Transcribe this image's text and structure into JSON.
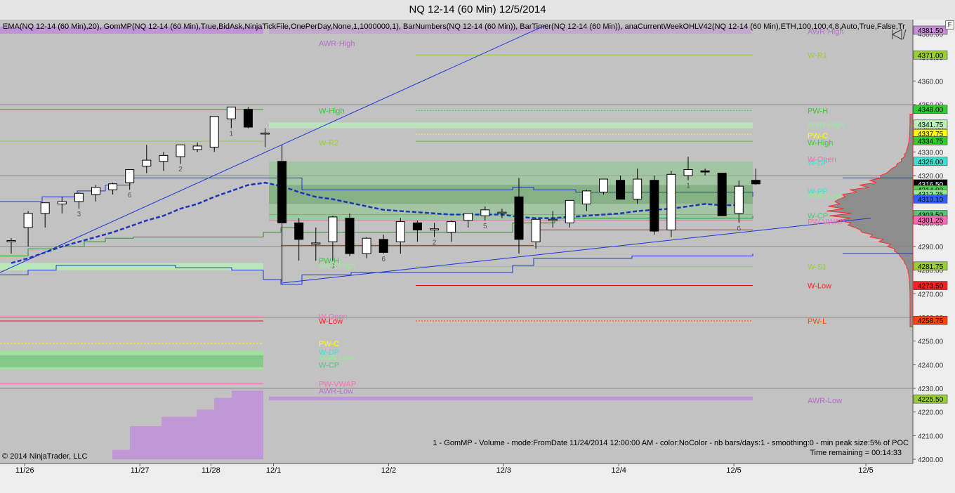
{
  "window": {
    "title": "NQ 12-14 (60 Min)  12/5/2014",
    "corner_button": "F"
  },
  "indicators_line": "EMA(NQ 12-14 (60 Min),20), GomMP(NQ 12-14 (60 Min),True,BidAsk,NinjaTickFile,OnePerDay,None,1,1000000,1), BarNumbers(NQ 12-14 (60 Min)), BarTimer(NQ 12-14 (60 Min)), anaCurrentWeekOHLV42(NQ 12-14 (60 Min),ETH,100,100,4,8,Auto,True,False,Tr",
  "gom_info": "1 - GomMP - Volume - mode:FromDate 11/24/2014 12:00:00 AM  - color:NoColor - nb bars/days:1 - smoothing:0 - min peak size:5% of POC",
  "time_remaining": "Time remaining = 00:14:33",
  "copyright": "© 2014 NinjaTrader, LLC",
  "chart_data": {
    "type": "candlestick",
    "title": "NQ 12-14 (60 Min)  12/5/2014",
    "ylim": [
      4200,
      4384
    ],
    "y_ticks": [
      "4200.00",
      "4210.00",
      "4220.00",
      "4230.00",
      "4240.00",
      "4250.00",
      "4260.00",
      "4270.00",
      "4280.00",
      "4290.00",
      "4300.00",
      "4310.00",
      "4320.00",
      "4330.00",
      "4340.00",
      "4350.00",
      "4360.00",
      "4370.00",
      "4380.00"
    ],
    "x_labels": [
      {
        "label": "11/26",
        "idx": 0.8
      },
      {
        "label": "11/27",
        "idx": 7.6
      },
      {
        "label": "11/28",
        "idx": 11.8
      },
      {
        "label": "12/1",
        "idx": 15.5
      },
      {
        "label": "12/2",
        "idx": 22.3
      },
      {
        "label": "12/3",
        "idx": 29.1
      },
      {
        "label": "12/4",
        "idx": 35.9
      },
      {
        "label": "12/5",
        "idx": 42.7
      },
      {
        "label": "12/5",
        "idx": 50.5
      }
    ],
    "candles": [
      {
        "o": 4292,
        "h": 4293.5,
        "l": 4287,
        "c": 4292.5
      },
      {
        "o": 4298,
        "h": 4305,
        "l": 4290,
        "c": 4304
      },
      {
        "o": 4304,
        "h": 4307,
        "l": 4298,
        "c": 4308.5
      },
      {
        "o": 4308,
        "h": 4311,
        "l": 4304,
        "c": 4309
      },
      {
        "o": 4309,
        "h": 4313,
        "l": 4306,
        "c": 4312.5
      },
      {
        "o": 4312,
        "h": 4316,
        "l": 4309,
        "c": 4315
      },
      {
        "o": 4314,
        "h": 4317,
        "l": 4312,
        "c": 4316.5
      },
      {
        "o": 4317,
        "h": 4322,
        "l": 4314,
        "c": 4322.5
      },
      {
        "o": 4324,
        "h": 4333,
        "l": 4321,
        "c": 4326.5
      },
      {
        "o": 4326,
        "h": 4330,
        "l": 4322,
        "c": 4328.5
      },
      {
        "o": 4328,
        "h": 4333,
        "l": 4325,
        "c": 4333
      },
      {
        "o": 4331,
        "h": 4334,
        "l": 4330,
        "c": 4332.5
      },
      {
        "o": 4332,
        "h": 4345,
        "l": 4330,
        "c": 4345
      },
      {
        "o": 4344,
        "h": 4349,
        "l": 4340,
        "c": 4349
      },
      {
        "o": 4348,
        "h": 4349,
        "l": 4340,
        "c": 4340.5
      },
      {
        "o": 4338,
        "h": 4340,
        "l": 4332,
        "c": 4338
      },
      {
        "o": 4326,
        "h": 4333,
        "l": 4275,
        "c": 4300
      },
      {
        "o": 4300,
        "h": 4302,
        "l": 4284,
        "c": 4293
      },
      {
        "o": 4291,
        "h": 4298,
        "l": 4284,
        "c": 4291.5
      },
      {
        "o": 4292,
        "h": 4303,
        "l": 4284,
        "c": 4302.5
      },
      {
        "o": 4302,
        "h": 4304,
        "l": 4286,
        "c": 4287
      },
      {
        "o": 4287,
        "h": 4294,
        "l": 4285,
        "c": 4293.5
      },
      {
        "o": 4293,
        "h": 4295,
        "l": 4287,
        "c": 4287.5
      },
      {
        "o": 4292,
        "h": 4302,
        "l": 4287,
        "c": 4300.5
      },
      {
        "o": 4300,
        "h": 4301,
        "l": 4292,
        "c": 4297
      },
      {
        "o": 4297,
        "h": 4300,
        "l": 4294,
        "c": 4297.5
      },
      {
        "o": 4296,
        "h": 4301,
        "l": 4292,
        "c": 4300.5
      },
      {
        "o": 4301,
        "h": 4304,
        "l": 4298,
        "c": 4304
      },
      {
        "o": 4303,
        "h": 4307,
        "l": 4301,
        "c": 4305.5
      },
      {
        "o": 4304,
        "h": 4306,
        "l": 4302,
        "c": 4304.5
      },
      {
        "o": 4311,
        "h": 4319,
        "l": 4287,
        "c": 4293
      },
      {
        "o": 4292,
        "h": 4302,
        "l": 4289,
        "c": 4301.5
      },
      {
        "o": 4301,
        "h": 4305,
        "l": 4298,
        "c": 4301.5
      },
      {
        "o": 4300,
        "h": 4309,
        "l": 4298,
        "c": 4309.5
      },
      {
        "o": 4308,
        "h": 4314,
        "l": 4305,
        "c": 4313.5
      },
      {
        "o": 4313,
        "h": 4318,
        "l": 4312,
        "c": 4318.5
      },
      {
        "o": 4318,
        "h": 4320,
        "l": 4310,
        "c": 4310
      },
      {
        "o": 4310,
        "h": 4323,
        "l": 4308,
        "c": 4318.5
      },
      {
        "o": 4318,
        "h": 4320,
        "l": 4295,
        "c": 4296.5
      },
      {
        "o": 4297,
        "h": 4322,
        "l": 4294,
        "c": 4320.5
      },
      {
        "o": 4320,
        "h": 4328,
        "l": 4318,
        "c": 4322.5
      },
      {
        "o": 4322,
        "h": 4323,
        "l": 4320,
        "c": 4321.5
      },
      {
        "o": 4321,
        "h": 4321,
        "l": 4303,
        "c": 4303
      },
      {
        "o": 4304,
        "h": 4318,
        "l": 4300,
        "c": 4315.5
      },
      {
        "o": 4318,
        "h": 4323,
        "l": 4316,
        "c": 4316.5
      }
    ],
    "bar_numbers": [
      {
        "n": "1",
        "idx": 13
      },
      {
        "n": "2",
        "idx": 10
      },
      {
        "n": "3",
        "idx": 4
      },
      {
        "n": "6",
        "idx": 7
      },
      {
        "n": "3",
        "idx": 19
      },
      {
        "n": "6",
        "idx": 22
      },
      {
        "n": "2",
        "idx": 25
      },
      {
        "n": "5",
        "idx": 28
      },
      {
        "n": "6",
        "idx": 43
      },
      {
        "n": "1",
        "idx": 40
      }
    ],
    "ema": [
      4283,
      4285,
      4287.5,
      4290,
      4292,
      4294,
      4296,
      4298.5,
      4301,
      4303,
      4306,
      4308,
      4311,
      4313.5,
      4316,
      4317,
      4315.5,
      4313,
      4311,
      4310,
      4308.5,
      4307,
      4305.5,
      4305,
      4304.5,
      4304,
      4303.5,
      4303.5,
      4303.5,
      4303.5,
      4302.5,
      4302,
      4302,
      4302.5,
      4303,
      4303.5,
      4304,
      4305,
      4305.5,
      4306,
      4307,
      4308,
      4307.5,
      4307.5
    ],
    "right_price_markers": [
      {
        "value": "4381.50",
        "bg": "#c88fd8",
        "y": 4381.5
      },
      {
        "value": "4371.00",
        "bg": "#9acd32",
        "y": 4371
      },
      {
        "value": "4348.00",
        "bg": "#32cd32",
        "y": 4348
      },
      {
        "value": "4341.75",
        "bg": "#b8f0b8",
        "y": 4341.75
      },
      {
        "value": "4337.75",
        "bg": "#ffff00",
        "y": 4337.75
      },
      {
        "value": "4334.75",
        "bg": "#32cd32",
        "y": 4334.75
      },
      {
        "value": "4326.00",
        "bg": "#40e0d0",
        "y": 4326
      },
      {
        "value": "4316.50",
        "bg": "#000000",
        "y": 4316.5,
        "fg": "#ffffff"
      },
      {
        "value": "4314.00",
        "bg": "#4fd04f",
        "y": 4314
      },
      {
        "value": "4312.25",
        "bg": "#90ee90",
        "y": 4312.25
      },
      {
        "value": "4310.10",
        "bg": "#3060ff",
        "y": 4310.1
      },
      {
        "value": "4303.50",
        "bg": "#50c878",
        "y": 4303.5
      },
      {
        "value": "4301.25",
        "bg": "#ff69b4",
        "y": 4301.25
      },
      {
        "value": "4281.75",
        "bg": "#9acd32",
        "y": 4281.75
      },
      {
        "value": "4273.50",
        "bg": "#ff2020",
        "y": 4273.5
      },
      {
        "value": "4258.75",
        "bg": "#ff4500",
        "y": 4258.75
      },
      {
        "value": "4225.50",
        "bg": "#9acd32",
        "y": 4225.5
      }
    ],
    "level_labels": [
      {
        "text": "AWR-High",
        "color": "#b36fc7",
        "y": 4381,
        "side": "right"
      },
      {
        "text": "AWR-High",
        "color": "#b36fc7",
        "y": 4376,
        "side": "left"
      },
      {
        "text": "W-R1",
        "color": "#9acd32",
        "y": 4371,
        "side": "right"
      },
      {
        "text": "W-High",
        "color": "#32cd32",
        "y": 4347.5,
        "side": "left"
      },
      {
        "text": "PW-H",
        "color": "#32cd32",
        "y": 4347.5,
        "side": "right"
      },
      {
        "text": "AWN-High",
        "color": "#a0e8a0",
        "y": 4341.5,
        "side": "right"
      },
      {
        "text": "PW-C",
        "color": "#ffff00",
        "y": 4337,
        "side": "right"
      },
      {
        "text": "W-High",
        "color": "#32cd32",
        "y": 4334,
        "side": "right"
      },
      {
        "text": "W-R2",
        "color": "#9acd32",
        "y": 4334,
        "side": "left"
      },
      {
        "text": "W-Open",
        "color": "#ff69b4",
        "y": 4327,
        "side": "right"
      },
      {
        "text": "W-DP",
        "color": "#40e0d0",
        "y": 4325.5,
        "side": "right"
      },
      {
        "text": "W-PP",
        "color": "#40e0d0",
        "y": 4313.5,
        "side": "right"
      },
      {
        "text": "AWN-Low",
        "color": "#90ee90",
        "y": 4311.5,
        "side": "right"
      },
      {
        "text": "W-CP",
        "color": "#50c878",
        "y": 4303,
        "side": "right"
      },
      {
        "text": "PW-VWAP",
        "color": "#ff69b4",
        "y": 4300.5,
        "side": "right"
      },
      {
        "text": "W-S1",
        "color": "#9acd32",
        "y": 4281.5,
        "side": "right"
      },
      {
        "text": "W-Low",
        "color": "#ff2020",
        "y": 4273.5,
        "side": "right"
      },
      {
        "text": "PW-L",
        "color": "#ff4500",
        "y": 4258.5,
        "side": "right"
      },
      {
        "text": "AWR-Low",
        "color": "#b36fc7",
        "y": 4225,
        "side": "right"
      },
      {
        "text": "PW-H",
        "color": "#32cd32",
        "y": 4284,
        "side": "left"
      },
      {
        "text": "AWR-High",
        "color": "#a0e8a0",
        "y": 4282,
        "side": "left"
      },
      {
        "text": "W-Open",
        "color": "#ff69b4",
        "y": 4260.5,
        "side": "left"
      },
      {
        "text": "W-Low",
        "color": "#ff2020",
        "y": 4258.5,
        "side": "left"
      },
      {
        "text": "PW-C",
        "color": "#ffff00",
        "y": 4249,
        "side": "left"
      },
      {
        "text": "W-DP",
        "color": "#40e0d0",
        "y": 4245.5,
        "side": "left"
      },
      {
        "text": "AWN-Low",
        "color": "#90ee90",
        "y": 4243,
        "side": "left"
      },
      {
        "text": "W-CP",
        "color": "#50c878",
        "y": 4240,
        "side": "left"
      },
      {
        "text": "PW-VWAP",
        "color": "#ff69b4",
        "y": 4232,
        "side": "left"
      },
      {
        "text": "AWR-Low",
        "color": "#b36fc7",
        "y": 4229,
        "side": "left"
      }
    ],
    "grid": true
  }
}
